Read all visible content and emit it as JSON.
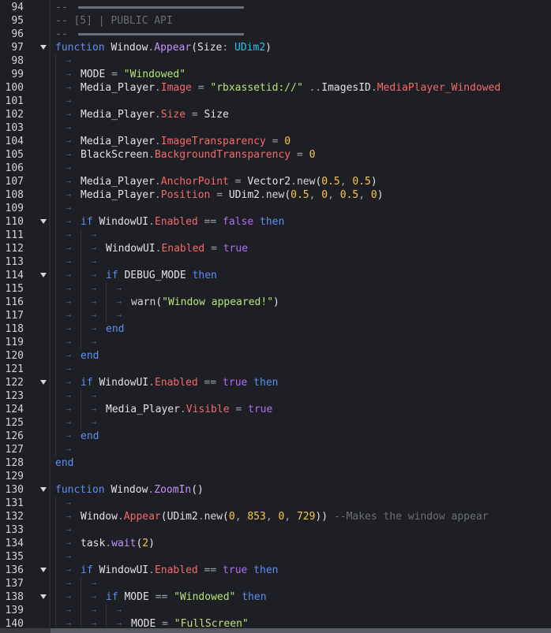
{
  "editor": {
    "lines": [
      {
        "n": "94",
        "fold": false,
        "indent": 0,
        "tokens": [
          [
            "cmt",
            "-- "
          ],
          [
            "hr",
            ""
          ]
        ]
      },
      {
        "n": "95",
        "fold": false,
        "indent": 0,
        "tokens": [
          [
            "cmt",
            "-- [5] | PUBLIC API"
          ]
        ]
      },
      {
        "n": "96",
        "fold": false,
        "indent": 0,
        "tokens": [
          [
            "cmt",
            "-- "
          ],
          [
            "hr",
            ""
          ]
        ]
      },
      {
        "n": "97",
        "fold": true,
        "indent": 0,
        "tokens": [
          [
            "kw",
            "function"
          ],
          [
            "id",
            " Window"
          ],
          [
            "op",
            "."
          ],
          [
            "meth",
            "Appear"
          ],
          [
            "id",
            "(Size"
          ],
          [
            "op",
            ": "
          ],
          [
            "type",
            "UDim2"
          ],
          [
            "id",
            ")"
          ]
        ]
      },
      {
        "n": "98",
        "fold": false,
        "indent": 1,
        "tokens": []
      },
      {
        "n": "99",
        "fold": false,
        "indent": 1,
        "tokens": [
          [
            "id",
            "MODE "
          ],
          [
            "op",
            "= "
          ],
          [
            "str",
            "\"Windowed\""
          ]
        ]
      },
      {
        "n": "100",
        "fold": false,
        "indent": 1,
        "tokens": [
          [
            "id",
            "Media_Player"
          ],
          [
            "op",
            "."
          ],
          [
            "prop",
            "Image"
          ],
          [
            "op",
            " = "
          ],
          [
            "str",
            "\"rbxassetid://\""
          ],
          [
            "op",
            " .."
          ],
          [
            "id",
            "ImagesID"
          ],
          [
            "op",
            "."
          ],
          [
            "prop",
            "MediaPlayer_Windowed"
          ]
        ]
      },
      {
        "n": "101",
        "fold": false,
        "indent": 1,
        "tokens": []
      },
      {
        "n": "102",
        "fold": false,
        "indent": 1,
        "tokens": [
          [
            "id",
            "Media_Player"
          ],
          [
            "op",
            "."
          ],
          [
            "prop",
            "Size"
          ],
          [
            "op",
            " = "
          ],
          [
            "id",
            "Size"
          ]
        ]
      },
      {
        "n": "103",
        "fold": false,
        "indent": 1,
        "tokens": []
      },
      {
        "n": "104",
        "fold": false,
        "indent": 1,
        "tokens": [
          [
            "id",
            "Media_Player"
          ],
          [
            "op",
            "."
          ],
          [
            "prop",
            "ImageTransparency"
          ],
          [
            "op",
            " = "
          ],
          [
            "num",
            "0"
          ]
        ]
      },
      {
        "n": "105",
        "fold": false,
        "indent": 1,
        "tokens": [
          [
            "id",
            "BlackScreen"
          ],
          [
            "op",
            "."
          ],
          [
            "prop",
            "BackgroundTransparency"
          ],
          [
            "op",
            " = "
          ],
          [
            "num",
            "0"
          ]
        ]
      },
      {
        "n": "106",
        "fold": false,
        "indent": 1,
        "tokens": []
      },
      {
        "n": "107",
        "fold": false,
        "indent": 1,
        "tokens": [
          [
            "id",
            "Media_Player"
          ],
          [
            "op",
            "."
          ],
          [
            "prop",
            "AnchorPoint"
          ],
          [
            "op",
            " = "
          ],
          [
            "id",
            "Vector2"
          ],
          [
            "op",
            "."
          ],
          [
            "fn",
            "new"
          ],
          [
            "id",
            "("
          ],
          [
            "num",
            "0.5"
          ],
          [
            "op",
            ", "
          ],
          [
            "num",
            "0.5"
          ],
          [
            "id",
            ")"
          ]
        ]
      },
      {
        "n": "108",
        "fold": false,
        "indent": 1,
        "tokens": [
          [
            "id",
            "Media_Player"
          ],
          [
            "op",
            "."
          ],
          [
            "prop",
            "Position"
          ],
          [
            "op",
            " = "
          ],
          [
            "id",
            "UDim2"
          ],
          [
            "op",
            "."
          ],
          [
            "fn",
            "new"
          ],
          [
            "id",
            "("
          ],
          [
            "num",
            "0.5"
          ],
          [
            "op",
            ", "
          ],
          [
            "num",
            "0"
          ],
          [
            "op",
            ", "
          ],
          [
            "num",
            "0.5"
          ],
          [
            "op",
            ", "
          ],
          [
            "num",
            "0"
          ],
          [
            "id",
            ")"
          ]
        ]
      },
      {
        "n": "109",
        "fold": false,
        "indent": 1,
        "tokens": []
      },
      {
        "n": "110",
        "fold": true,
        "indent": 1,
        "tokens": [
          [
            "kw",
            "if"
          ],
          [
            "id",
            " WindowUI"
          ],
          [
            "op",
            "."
          ],
          [
            "prop",
            "Enabled"
          ],
          [
            "op",
            " == "
          ],
          [
            "bool",
            "false"
          ],
          [
            "kw",
            " then"
          ]
        ]
      },
      {
        "n": "111",
        "fold": false,
        "indent": 2,
        "tokens": []
      },
      {
        "n": "112",
        "fold": false,
        "indent": 2,
        "tokens": [
          [
            "id",
            "WindowUI"
          ],
          [
            "op",
            "."
          ],
          [
            "prop",
            "Enabled"
          ],
          [
            "op",
            " = "
          ],
          [
            "bool",
            "true"
          ]
        ]
      },
      {
        "n": "113",
        "fold": false,
        "indent": 2,
        "tokens": []
      },
      {
        "n": "114",
        "fold": true,
        "indent": 2,
        "tokens": [
          [
            "kw",
            "if"
          ],
          [
            "id",
            " DEBUG_MODE"
          ],
          [
            "kw",
            " then"
          ]
        ]
      },
      {
        "n": "115",
        "fold": false,
        "indent": 3,
        "tokens": []
      },
      {
        "n": "116",
        "fold": false,
        "indent": 3,
        "tokens": [
          [
            "fn",
            "warn"
          ],
          [
            "id",
            "("
          ],
          [
            "str",
            "\"Window appeared!\""
          ],
          [
            "id",
            ")"
          ]
        ]
      },
      {
        "n": "117",
        "fold": false,
        "indent": 3,
        "tokens": []
      },
      {
        "n": "118",
        "fold": false,
        "indent": 2,
        "tokens": [
          [
            "kw",
            "end"
          ]
        ]
      },
      {
        "n": "119",
        "fold": false,
        "indent": 2,
        "tokens": []
      },
      {
        "n": "120",
        "fold": false,
        "indent": 1,
        "tokens": [
          [
            "kw",
            "end"
          ]
        ]
      },
      {
        "n": "121",
        "fold": false,
        "indent": 1,
        "tokens": []
      },
      {
        "n": "122",
        "fold": true,
        "indent": 1,
        "tokens": [
          [
            "kw",
            "if"
          ],
          [
            "id",
            " WindowUI"
          ],
          [
            "op",
            "."
          ],
          [
            "prop",
            "Enabled"
          ],
          [
            "op",
            " == "
          ],
          [
            "bool",
            "true"
          ],
          [
            "kw",
            " then"
          ]
        ]
      },
      {
        "n": "123",
        "fold": false,
        "indent": 2,
        "tokens": []
      },
      {
        "n": "124",
        "fold": false,
        "indent": 2,
        "tokens": [
          [
            "id",
            "Media_Player"
          ],
          [
            "op",
            "."
          ],
          [
            "prop",
            "Visible"
          ],
          [
            "op",
            " = "
          ],
          [
            "bool",
            "true"
          ]
        ]
      },
      {
        "n": "125",
        "fold": false,
        "indent": 2,
        "tokens": []
      },
      {
        "n": "126",
        "fold": false,
        "indent": 1,
        "tokens": [
          [
            "kw",
            "end"
          ]
        ]
      },
      {
        "n": "127",
        "fold": false,
        "indent": 1,
        "tokens": []
      },
      {
        "n": "128",
        "fold": false,
        "indent": 0,
        "tokens": [
          [
            "kw",
            "end"
          ]
        ]
      },
      {
        "n": "129",
        "fold": false,
        "indent": 0,
        "tokens": []
      },
      {
        "n": "130",
        "fold": true,
        "indent": 0,
        "tokens": [
          [
            "kw",
            "function"
          ],
          [
            "id",
            " Window"
          ],
          [
            "op",
            "."
          ],
          [
            "meth",
            "ZoomIn"
          ],
          [
            "id",
            "()"
          ]
        ]
      },
      {
        "n": "131",
        "fold": false,
        "indent": 1,
        "tokens": []
      },
      {
        "n": "132",
        "fold": false,
        "indent": 1,
        "tokens": [
          [
            "id",
            "Window"
          ],
          [
            "op",
            "."
          ],
          [
            "prop",
            "Appear"
          ],
          [
            "id",
            "("
          ],
          [
            "id",
            "UDim2"
          ],
          [
            "op",
            "."
          ],
          [
            "fn",
            "new"
          ],
          [
            "id",
            "("
          ],
          [
            "num",
            "0"
          ],
          [
            "op",
            ", "
          ],
          [
            "num",
            "853"
          ],
          [
            "op",
            ", "
          ],
          [
            "num",
            "0"
          ],
          [
            "op",
            ", "
          ],
          [
            "num",
            "729"
          ],
          [
            "id",
            "))"
          ],
          [
            "cmt",
            " --Makes the window appear"
          ]
        ]
      },
      {
        "n": "133",
        "fold": false,
        "indent": 1,
        "tokens": []
      },
      {
        "n": "134",
        "fold": false,
        "indent": 1,
        "tokens": [
          [
            "id",
            "task"
          ],
          [
            "op",
            "."
          ],
          [
            "meth",
            "wait"
          ],
          [
            "id",
            "("
          ],
          [
            "num",
            "2"
          ],
          [
            "id",
            ")"
          ]
        ]
      },
      {
        "n": "135",
        "fold": false,
        "indent": 1,
        "tokens": []
      },
      {
        "n": "136",
        "fold": true,
        "indent": 1,
        "tokens": [
          [
            "kw",
            "if"
          ],
          [
            "id",
            " WindowUI"
          ],
          [
            "op",
            "."
          ],
          [
            "prop",
            "Enabled"
          ],
          [
            "op",
            " == "
          ],
          [
            "bool",
            "true"
          ],
          [
            "kw",
            " then"
          ]
        ]
      },
      {
        "n": "137",
        "fold": false,
        "indent": 2,
        "tokens": []
      },
      {
        "n": "138",
        "fold": true,
        "indent": 2,
        "tokens": [
          [
            "kw",
            "if"
          ],
          [
            "id",
            " MODE"
          ],
          [
            "op",
            " == "
          ],
          [
            "str",
            "\"Windowed\""
          ],
          [
            "kw",
            " then"
          ]
        ]
      },
      {
        "n": "139",
        "fold": false,
        "indent": 3,
        "tokens": []
      },
      {
        "n": "140",
        "fold": false,
        "indent": 3,
        "tokens": [
          [
            "id",
            "MODE "
          ],
          [
            "op",
            "= "
          ],
          [
            "str",
            "\"FullScreen\""
          ]
        ]
      }
    ]
  }
}
